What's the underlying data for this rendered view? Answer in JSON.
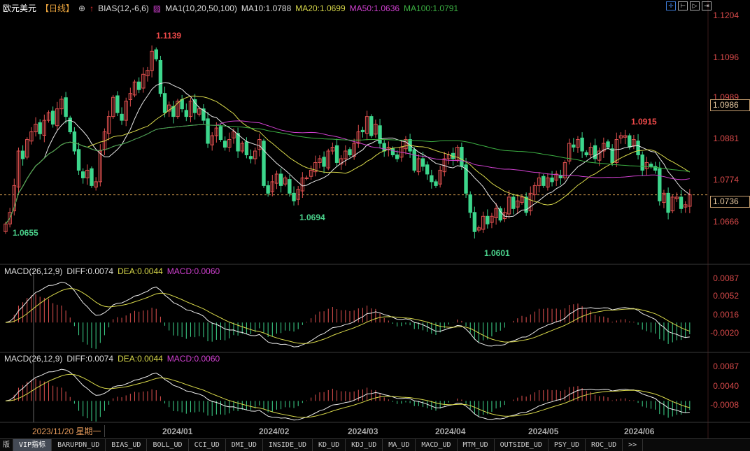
{
  "header": {
    "symbol": "欧元美元",
    "period": "【日线】",
    "bias": "BIAS(12,-6,6)",
    "ma_title": "MA1(10,20,50,100)",
    "ma10": "MA10:1.0788",
    "ma20": "MA20:1.0699",
    "ma50": "MA50:1.0636",
    "ma100": "MA100:1.0791"
  },
  "toolbar": [
    "crosshair",
    "zoom-start",
    "play",
    "exit"
  ],
  "price_axis": [
    "1.1204",
    "1.1096",
    "1.0989",
    "1.0881",
    "1.0774",
    "1.0666"
  ],
  "price_markers": {
    "last_close": "1.0736",
    "crosshair": "1.0986"
  },
  "annotations": {
    "high1": "1.1139",
    "low1": "1.0655",
    "low2": "1.0694",
    "low3": "1.0601",
    "high2": "1.0915"
  },
  "macd1": {
    "title": "MACD(26,12,9)",
    "diff": "DIFF:0.0074",
    "dea": "DEA:0.0044",
    "macd": "MACD:0.0060",
    "axis": [
      "0.0087",
      "0.0052",
      "0.0016",
      "-0.0020"
    ]
  },
  "macd2": {
    "title": "MACD(26,12,9)",
    "diff": "DIFF:0.0074",
    "dea": "DEA:0.0044",
    "macd": "MACD:0.0060",
    "axis": [
      "0.0087",
      "0.0040",
      "-0.0008"
    ]
  },
  "date_axis": {
    "cursor": "2023/11/20 星期一",
    "labels": [
      "2024/01",
      "2024/02",
      "2024/03",
      "2024/04",
      "2024/05",
      "2024/06"
    ]
  },
  "tabs": [
    "版",
    "VIP指标",
    "BARUPDN_UD",
    "BIAS_UD",
    "BOLL_UD",
    "CCI_UD",
    "DMI_UD",
    "INSIDE_UD",
    "KD_UD",
    "KDJ_UD",
    "MA_UD",
    "MACD_UD",
    "MTM_UD",
    "OUTSIDE_UD",
    "PSY_UD",
    "ROC_UD",
    ">>"
  ],
  "colors": {
    "up": "#e0504f",
    "down": "#3dd68c",
    "ma10": "#e8e8e8",
    "ma20": "#d8d84a",
    "ma50": "#d040d0",
    "ma100": "#3cb043",
    "dea": "#d8d84a"
  },
  "chart_data": {
    "type": "candlestick",
    "ylim": [
      1.056,
      1.123
    ],
    "closes": [
      1.066,
      1.069,
      1.076,
      1.085,
      1.083,
      1.088,
      1.09,
      1.092,
      1.0895,
      1.093,
      1.095,
      1.092,
      1.096,
      1.0985,
      1.094,
      1.09,
      1.085,
      1.08,
      1.078,
      1.08,
      1.076,
      1.077,
      1.085,
      1.09,
      1.094,
      1.099,
      1.095,
      1.093,
      1.098,
      1.1,
      1.103,
      1.101,
      1.105,
      1.106,
      1.111,
      1.109,
      1.1,
      1.095,
      1.097,
      1.094,
      1.098,
      1.096,
      1.094,
      1.098,
      1.095,
      1.096,
      1.093,
      1.087,
      1.089,
      1.091,
      1.088,
      1.086,
      1.088,
      1.09,
      1.085,
      1.087,
      1.084,
      1.083,
      1.085,
      1.088,
      1.076,
      1.074,
      1.077,
      1.079,
      1.076,
      1.078,
      1.074,
      1.072,
      1.075,
      1.078,
      1.078,
      1.08,
      1.082,
      1.083,
      1.081,
      1.085,
      1.086,
      1.082,
      1.083,
      1.085,
      1.084,
      1.087,
      1.09,
      1.09,
      1.094,
      1.089,
      1.092,
      1.087,
      1.085,
      1.086,
      1.084,
      1.083,
      1.086,
      1.088,
      1.085,
      1.08,
      1.083,
      1.081,
      1.079,
      1.077,
      1.076,
      1.08,
      1.083,
      1.084,
      1.083,
      1.086,
      1.081,
      1.074,
      1.069,
      1.064,
      1.065,
      1.068,
      1.066,
      1.068,
      1.07,
      1.067,
      1.069,
      1.073,
      1.07,
      1.072,
      1.073,
      1.069,
      1.074,
      1.076,
      1.078,
      1.076,
      1.078,
      1.077,
      1.079,
      1.078,
      1.082,
      1.087,
      1.086,
      1.088,
      1.085,
      1.084,
      1.086,
      1.083,
      1.085,
      1.087,
      1.086,
      1.082,
      1.088,
      1.089,
      1.089,
      1.086,
      1.088,
      1.084,
      1.08,
      1.082,
      1.081,
      1.08,
      1.072,
      1.074,
      1.069,
      1.073,
      1.073,
      1.07,
      1.071,
      1.0736
    ]
  }
}
